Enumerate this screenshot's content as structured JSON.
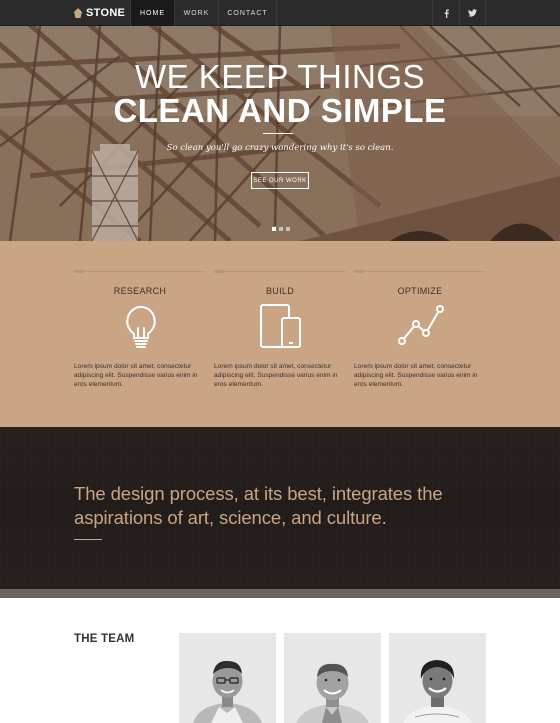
{
  "nav": {
    "logo": "STONE",
    "items": [
      {
        "label": "HOME",
        "active": true
      },
      {
        "label": "WORK",
        "active": false
      },
      {
        "label": "CONTACT",
        "active": false
      }
    ],
    "social": [
      "facebook-icon",
      "twitter-icon"
    ]
  },
  "hero": {
    "title_line1": "WE KEEP THINGS",
    "title_line2": "CLEAN AND SIMPLE",
    "subtitle": "So clean you'll go crazy wondering why it's so clean.",
    "button": "SEE OUR WORK",
    "slides": 3,
    "active_slide": 1
  },
  "features": [
    {
      "title": "RESEARCH",
      "icon": "lightbulb-icon",
      "text": "Lorem ipsum dolor sit amet, consectetur adipiscing elit. Suspendisse varius enim in eros elementum."
    },
    {
      "title": "BUILD",
      "icon": "devices-icon",
      "text": "Lorem ipsum dolor sit amet, consectetur adipiscing elit. Suspendisse varius enim in eros elementum."
    },
    {
      "title": "OPTIMIZE",
      "icon": "line-graph-icon",
      "text": "Lorem ipsum dolor sit amet, consectetur adipiscing elit. Suspendisse varius enim in eros elementum."
    }
  ],
  "quote": "The design process, at its best, integrates the aspirations of art, science, and culture.",
  "team": {
    "heading": "THE TEAM",
    "members": [
      "man-with-glasses",
      "man-smiling",
      "woman-smiling"
    ]
  },
  "colors": {
    "nav_bg": "#2b2b2b",
    "accent": "#c9a585",
    "dark": "#231e1b"
  }
}
